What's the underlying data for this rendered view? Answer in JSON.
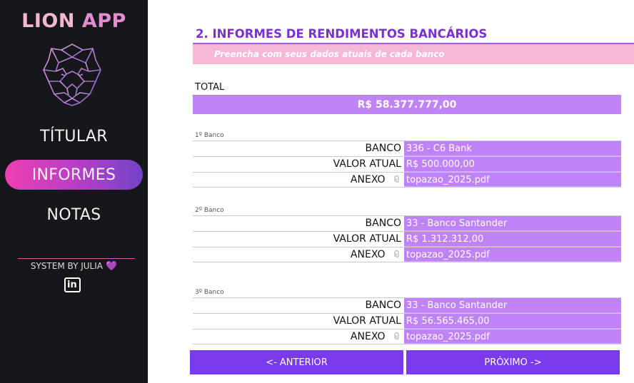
{
  "app": {
    "title_part1": "LION",
    "title_part2": "APP"
  },
  "sidebar": {
    "items": [
      {
        "label": "TÍTULAR",
        "active": false
      },
      {
        "label": "INFORMES",
        "active": true
      },
      {
        "label": "NOTAS",
        "active": false
      }
    ],
    "credit": "SYSTEM BY JULIA",
    "linkedin_label": "in"
  },
  "main": {
    "title": "2. INFORMES DE RENDIMENTOS BANCÁRIOS",
    "subtitle": "Preencha com seus dados atuais de cada banco",
    "total_label": "TOTAL",
    "total_value": "R$ 58.377.777,00",
    "field_labels": {
      "bank": "BANCO",
      "value": "VALOR ATUAL",
      "attachment": "ANEXO"
    },
    "banks": [
      {
        "heading": "1º Banco",
        "bank": "336 - C6 Bank",
        "value": "R$ 500.000,00",
        "attachment": "topazao_2025.pdf"
      },
      {
        "heading": "2º Banco",
        "bank": "33 - Banco Santander",
        "value": "R$ 1.312.312,00",
        "attachment": "topazao_2025.pdf"
      },
      {
        "heading": "3º Banco",
        "bank": "33 - Banco Santander",
        "value": "R$ 56.565.465,00",
        "attachment": "topazao_2025.pdf"
      }
    ],
    "prev_button": "<- ANTERIOR",
    "next_button": "PRÓXIMO ->"
  },
  "colors": {
    "sidebar_bg": "#16171b",
    "accent_purple": "#7c3aed",
    "field_purple": "#c083f7",
    "subtitle_pink": "#f4b8d4"
  }
}
